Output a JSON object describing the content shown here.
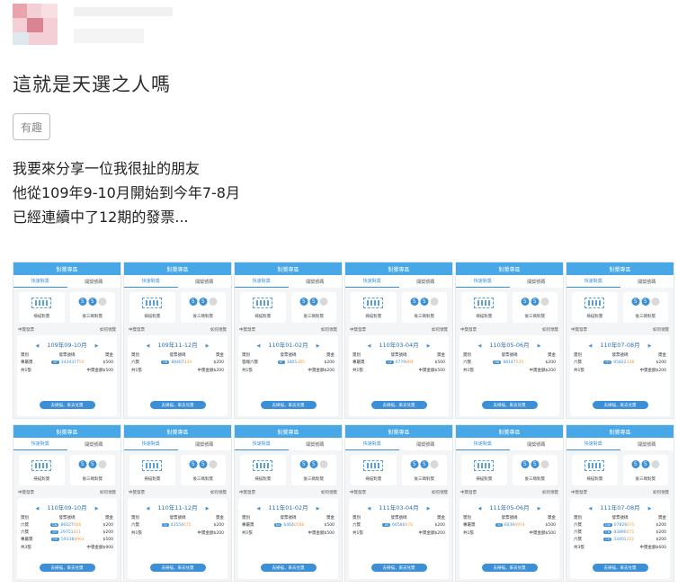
{
  "post": {
    "title": "這就是天選之人嗎",
    "tag": "有趣",
    "lines": [
      "我要來分享一位我很扯的朋友",
      "他從109年9-10月開始到今年7-8月",
      "已經連續中了12期的發票..."
    ]
  },
  "card_common": {
    "header": "對獎專區",
    "tab_left": "快速對獎",
    "tab_right": "開獎號碼",
    "scan_label": "掃描對獎",
    "last_three_label": "後三碼對獎",
    "winning_label": "中獎發票",
    "how_to_claim": "如何領獎",
    "col_prize": "獎別",
    "col_number": "發票號碼",
    "col_amount": "獎金",
    "button": "去掃描，來去兌獎",
    "ball_value": "5"
  },
  "cards": [
    {
      "period": "109年09-10月",
      "rows": [
        {
          "prize": "專屬獎",
          "code": "RT",
          "num": "3434377",
          "tail": "50",
          "amount": "$500"
        }
      ],
      "count": "共1張",
      "total": "中獎金額$500"
    },
    {
      "period": "109年11-12月",
      "rows": [
        {
          "prize": "六獎",
          "code": "HR",
          "num": "88407",
          "tail": "334",
          "amount": "$200"
        }
      ],
      "count": "共1張",
      "total": "中獎金額$200"
    },
    {
      "period": "110年01-02月",
      "rows": [
        {
          "prize": "雲端六獎",
          "code": "KT",
          "num": "1805",
          "tail": "385",
          "amount": "$200"
        }
      ],
      "count": "共1張",
      "total": "中獎金額$200"
    },
    {
      "period": "110年03-04月",
      "rows": [
        {
          "prize": "專屬獎",
          "code": "LX",
          "num": "0779",
          "tail": "884",
          "amount": "$500"
        }
      ],
      "count": "共1張",
      "total": "中獎金額$500"
    },
    {
      "period": "110年05-06月",
      "rows": [
        {
          "prize": "六獎",
          "code": "NB",
          "num": "88147",
          "tail": "535",
          "amount": "$200"
        }
      ],
      "count": "共1張",
      "total": "中獎金額$200"
    },
    {
      "period": "110年07-08月",
      "rows": [
        {
          "prize": "六獎",
          "code": "QY",
          "num": "95822",
          "tail": "338",
          "amount": "$200"
        }
      ],
      "count": "共1張",
      "total": "中獎金額$200"
    },
    {
      "period": "110年09-10月",
      "rows": [
        {
          "prize": "六獎",
          "code": "GN",
          "num": "86027",
          "tail": "000",
          "amount": "$200"
        },
        {
          "prize": "六獎",
          "code": "GT",
          "num": "29751",
          "tail": "621",
          "amount": "$200"
        },
        {
          "prize": "專屬獎",
          "code": "HY",
          "num": "59338",
          "tail": "8961",
          "amount": "$500"
        }
      ],
      "count": "共3張",
      "total": "中獎金額$900"
    },
    {
      "period": "110年11-12月",
      "rows": [
        {
          "prize": "六獎",
          "code": "QJ",
          "num": "43554",
          "tail": "675",
          "amount": "$200"
        }
      ],
      "count": "共1張",
      "total": "中獎金額$200"
    },
    {
      "period": "111年01-02月",
      "rows": [
        {
          "prize": "專屬獎",
          "code": "KA",
          "num": "6464",
          "tail": "0586",
          "amount": "$500"
        }
      ],
      "count": "共1張",
      "total": "中獎金額$500"
    },
    {
      "period": "111年03-04月",
      "rows": [
        {
          "prize": "六獎",
          "code": "XK",
          "num": "66580",
          "tail": "076",
          "amount": "$200"
        }
      ],
      "count": "共1張",
      "total": "中獎金額$200"
    },
    {
      "period": "111年05-06月",
      "rows": [
        {
          "prize": "專屬獎",
          "code": "EJ",
          "num": "6039",
          "tail": "4974",
          "amount": "$500"
        }
      ],
      "count": "共1張",
      "total": "中獎金額$500"
    },
    {
      "period": "111年07-08月",
      "rows": [
        {
          "prize": "六獎",
          "code": "CW",
          "num": "07826",
          "tail": "075",
          "amount": "$200"
        },
        {
          "prize": "六獎",
          "code": "CN",
          "num": "83890",
          "tail": "075",
          "amount": "$200"
        },
        {
          "prize": "六獎",
          "code": "CV",
          "num": "33401",
          "tail": "222",
          "amount": "$200"
        }
      ],
      "count": "共3張",
      "total": "中獎金額$600"
    }
  ]
}
